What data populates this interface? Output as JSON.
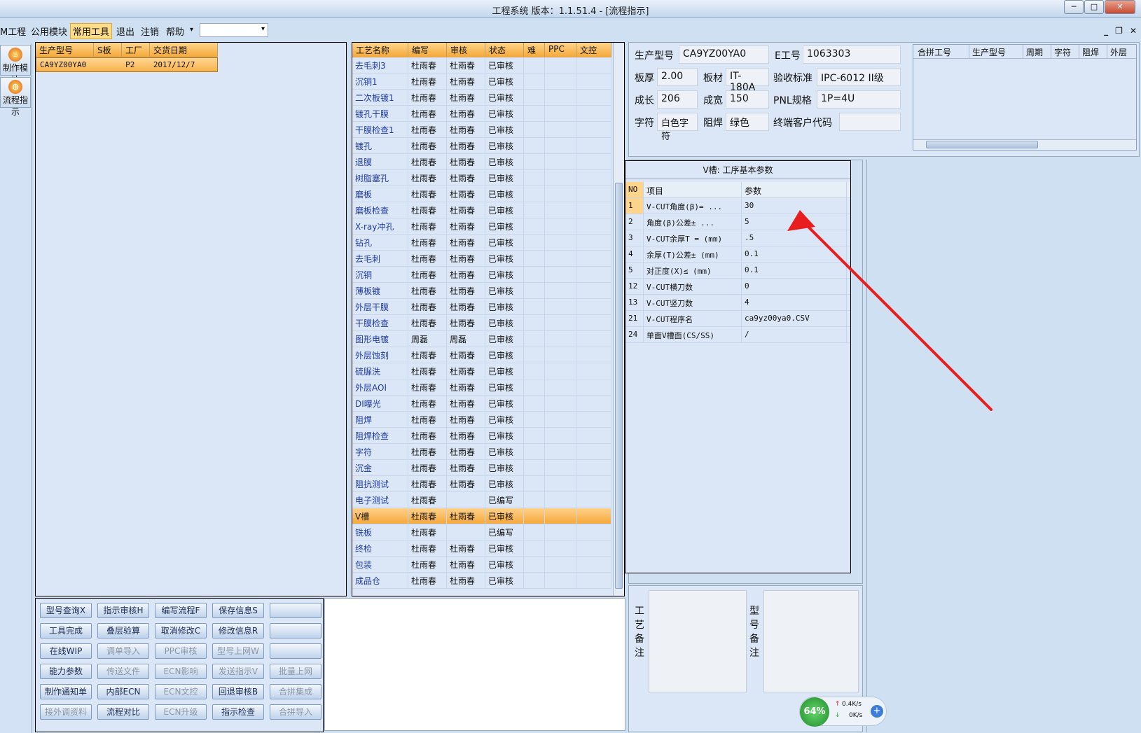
{
  "window": {
    "title": "工程系统  版本：1.1.51.4 - [流程指示]",
    "min": "─",
    "max": "□",
    "close": "✕"
  },
  "menu": {
    "items": [
      "M工程",
      "公用模块",
      "常用工具",
      "退出",
      "注销",
      "帮助"
    ],
    "dropdown_arrow": "▾",
    "combo_value": ""
  },
  "mdi": {
    "min": "_",
    "restore": "❐",
    "close": "✕"
  },
  "side": [
    {
      "label": "制作模块",
      "icon": "flame-icon"
    },
    {
      "label": "流程指示",
      "icon": "flow-icon"
    }
  ],
  "product_grid": {
    "headers": [
      "生产型号",
      "S板",
      "工厂",
      "交货日期"
    ],
    "rows": [
      [
        "CA9YZ00YA0",
        "",
        "P2",
        "2017/12/7"
      ]
    ]
  },
  "process_grid": {
    "headers": [
      "工艺名称",
      "编写",
      "审核",
      "状态",
      "难",
      "PPC",
      "文控"
    ],
    "rows": [
      [
        "去毛刺3",
        "杜雨春",
        "杜雨春",
        "已审核"
      ],
      [
        "沉铜1",
        "杜雨春",
        "杜雨春",
        "已审核"
      ],
      [
        "二次板镀1",
        "杜雨春",
        "杜雨春",
        "已审核"
      ],
      [
        "镀孔干膜",
        "杜雨春",
        "杜雨春",
        "已审核"
      ],
      [
        "干膜检查1",
        "杜雨春",
        "杜雨春",
        "已审核"
      ],
      [
        "镀孔",
        "杜雨春",
        "杜雨春",
        "已审核"
      ],
      [
        "退膜",
        "杜雨春",
        "杜雨春",
        "已审核"
      ],
      [
        "树脂塞孔",
        "杜雨春",
        "杜雨春",
        "已审核"
      ],
      [
        "磨板",
        "杜雨春",
        "杜雨春",
        "已审核"
      ],
      [
        "磨板检查",
        "杜雨春",
        "杜雨春",
        "已审核"
      ],
      [
        "X-ray冲孔",
        "杜雨春",
        "杜雨春",
        "已审核"
      ],
      [
        "钻孔",
        "杜雨春",
        "杜雨春",
        "已审核"
      ],
      [
        "去毛刺",
        "杜雨春",
        "杜雨春",
        "已审核"
      ],
      [
        "沉铜",
        "杜雨春",
        "杜雨春",
        "已审核"
      ],
      [
        "薄板镀",
        "杜雨春",
        "杜雨春",
        "已审核"
      ],
      [
        "外层干膜",
        "杜雨春",
        "杜雨春",
        "已审核"
      ],
      [
        "干膜检查",
        "杜雨春",
        "杜雨春",
        "已审核"
      ],
      [
        "图形电镀",
        "周磊",
        "周磊",
        "已审核"
      ],
      [
        "外层蚀刻",
        "杜雨春",
        "杜雨春",
        "已审核"
      ],
      [
        "硫脲洗",
        "杜雨春",
        "杜雨春",
        "已审核"
      ],
      [
        "外层AOI",
        "杜雨春",
        "杜雨春",
        "已审核"
      ],
      [
        "DI曝光",
        "杜雨春",
        "杜雨春",
        "已审核"
      ],
      [
        "阻焊",
        "杜雨春",
        "杜雨春",
        "已审核"
      ],
      [
        "阻焊检查",
        "杜雨春",
        "杜雨春",
        "已审核"
      ],
      [
        "字符",
        "杜雨春",
        "杜雨春",
        "已审核"
      ],
      [
        "沉金",
        "杜雨春",
        "杜雨春",
        "已审核"
      ],
      [
        "阻抗测试",
        "杜雨春",
        "杜雨春",
        "已审核"
      ],
      [
        "电子测试",
        "杜雨春",
        "",
        "已编写"
      ],
      [
        "V槽",
        "杜雨春",
        "杜雨春",
        "已审核"
      ],
      [
        "铣板",
        "杜雨春",
        "",
        "已编写"
      ],
      [
        "终检",
        "杜雨春",
        "杜雨春",
        "已审核"
      ],
      [
        "包装",
        "杜雨春",
        "杜雨春",
        "已审核"
      ],
      [
        "成品仓",
        "杜雨春",
        "杜雨春",
        "已审核"
      ]
    ],
    "selected_index": 28
  },
  "buttons": [
    [
      {
        "label": "型号查询X",
        "enabled": true
      },
      {
        "label": "指示审核H",
        "enabled": true
      },
      {
        "label": "编写流程F",
        "enabled": true
      },
      {
        "label": "保存信息S",
        "enabled": true
      },
      {
        "label": "",
        "enabled": true
      }
    ],
    [
      {
        "label": "工具完成",
        "enabled": true
      },
      {
        "label": "叠层验算",
        "enabled": true
      },
      {
        "label": "取消修改C",
        "enabled": true
      },
      {
        "label": "修改信息R",
        "enabled": true
      },
      {
        "label": "",
        "enabled": true
      }
    ],
    [
      {
        "label": "在线WIP",
        "enabled": true
      },
      {
        "label": "调单导入",
        "enabled": false
      },
      {
        "label": "PPC审核",
        "enabled": false
      },
      {
        "label": "型号上网W",
        "enabled": false
      },
      {
        "label": "",
        "enabled": true
      }
    ],
    [
      {
        "label": "能力参数",
        "enabled": true
      },
      {
        "label": "传送文件",
        "enabled": false
      },
      {
        "label": "ECN影响",
        "enabled": false
      },
      {
        "label": "发送指示V",
        "enabled": false
      },
      {
        "label": "批量上网",
        "enabled": false
      }
    ],
    [
      {
        "label": "制作通知单",
        "enabled": true
      },
      {
        "label": "内部ECN",
        "enabled": true
      },
      {
        "label": "ECN文控",
        "enabled": false
      },
      {
        "label": "回退审核B",
        "enabled": true
      },
      {
        "label": "合拼集成",
        "enabled": false
      }
    ],
    [
      {
        "label": "接外调资料",
        "enabled": false
      },
      {
        "label": "流程对比",
        "enabled": true
      },
      {
        "label": "ECN升级",
        "enabled": false
      },
      {
        "label": "指示检查",
        "enabled": true
      },
      {
        "label": "合拼导入",
        "enabled": false
      }
    ]
  ],
  "info": {
    "prod_label": "生产型号",
    "prod_value": "CA9YZ00YA0",
    "eno_label": "E工号",
    "eno_value": "1063303",
    "thick_label": "板厚",
    "thick_value": "2.00",
    "mat_label": "板材",
    "mat_value": "IT-180A",
    "std_label": "验收标准",
    "std_value": "IPC-6012 II级",
    "len_label": "成长",
    "len_value": "206",
    "wid_label": "成宽",
    "wid_value": "150",
    "pnl_label": "PNL规格",
    "pnl_value": "1P=4U",
    "char_label": "字符",
    "char_value": "白色字符",
    "mask_label": "阻焊",
    "mask_value": "绿色",
    "cust_label": "终端客户代码",
    "cust_value": ""
  },
  "merge_grid": {
    "headers": [
      "合拼工号",
      "生产型号",
      "周期",
      "字符",
      "阻焊",
      "外层"
    ]
  },
  "vslot": {
    "title": "V槽: 工序基本参数",
    "headers": [
      "NO",
      "项目",
      "参数"
    ],
    "rows": [
      [
        "1",
        "V-CUT角度(β)=  ...",
        "30"
      ],
      [
        "2",
        "角度(β)公差±  ...",
        "5"
      ],
      [
        "3",
        "V-CUT余厚T =  (mm)",
        ".5"
      ],
      [
        "4",
        "余厚(T)公差±  (mm)",
        "0.1"
      ],
      [
        "5",
        "对正度(X)≤ (mm)",
        "0.1"
      ],
      [
        "12",
        "V-CUT横刀数",
        "0"
      ],
      [
        "13",
        "V-CUT竖刀数",
        "4"
      ],
      [
        "21",
        "V-CUT程序名",
        "ca9yz00ya0.CSV"
      ],
      [
        "24",
        "单面V槽面(CS/SS)",
        "/"
      ]
    ]
  },
  "notes": {
    "process_label": "工艺备注",
    "model_label": "型号备注",
    "process_text": "",
    "model_text": ""
  },
  "netmon": {
    "percent": "64%",
    "up": "0.4K/s",
    "down": "0K/s"
  },
  "colors": {
    "accent": "#f5a83a",
    "annotation": "#e81d1d",
    "link": "#1f3aa0"
  }
}
